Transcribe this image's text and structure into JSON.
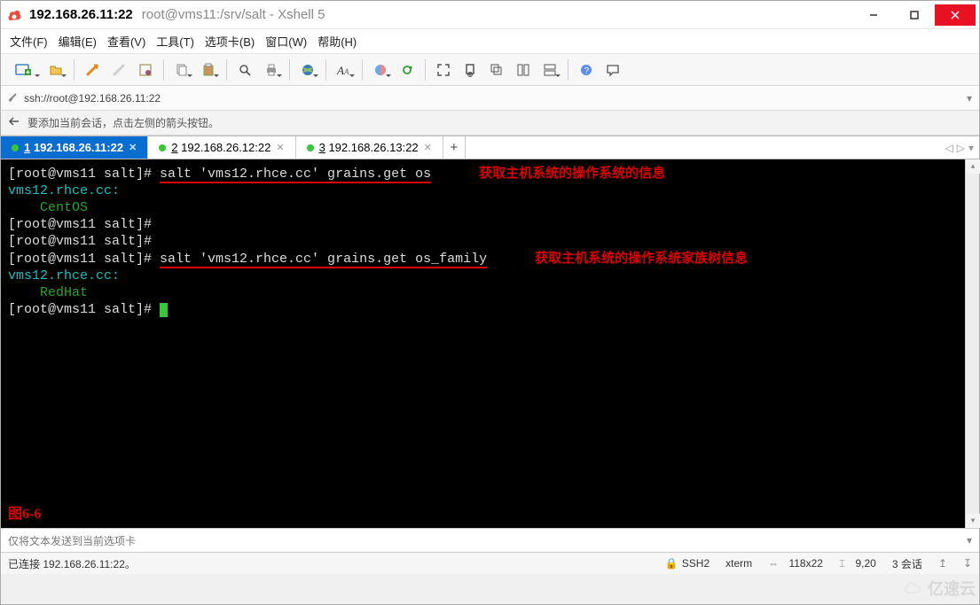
{
  "window": {
    "title_strong": "192.168.26.11:22",
    "title_rest": "root@vms11:/srv/salt - Xshell 5"
  },
  "menu": {
    "file": "文件(F)",
    "edit": "编辑(E)",
    "view": "查看(V)",
    "tools": "工具(T)",
    "tabs": "选项卡(B)",
    "window": "窗口(W)",
    "help": "帮助(H)"
  },
  "toolbar_icons": {
    "new_session": "new-session",
    "open": "open",
    "reconnect": "reconnect",
    "disconnect": "disconnect",
    "properties": "properties",
    "copy": "copy",
    "paste": "paste",
    "find": "find",
    "print": "print",
    "globe": "globe",
    "font": "font",
    "color": "color-scheme",
    "refresh": "refresh",
    "fullscreen": "fullscreen",
    "simple": "simple-mode",
    "cascade": "cascade",
    "tile_h": "tile-horizontal",
    "tile_v": "tile-vertical",
    "help": "help",
    "feedback": "feedback"
  },
  "address": {
    "url": "ssh://root@192.168.26.11:22"
  },
  "hint": {
    "text": "要添加当前会话，点击左侧的箭头按钮。"
  },
  "tabs": [
    {
      "n": "1",
      "label": "192.168.26.11:22",
      "active": true
    },
    {
      "n": "2",
      "label": "192.168.26.12:22",
      "active": false
    },
    {
      "n": "3",
      "label": "192.168.26.13:22",
      "active": false
    }
  ],
  "terminal": {
    "l1_prompt": "[root@vms11 salt]# ",
    "l1_cmd": "salt 'vms12.rhce.cc' grains.get os",
    "l1_annot": "获取主机系统的操作系统的信息",
    "l2_host": "vms12.rhce.cc:",
    "l3_value": "    CentOS",
    "l4_prompt": "[root@vms11 salt]# ",
    "l5_prompt": "[root@vms11 salt]# ",
    "l6_prompt": "[root@vms11 salt]# ",
    "l6_cmd": "salt 'vms12.rhce.cc' grains.get os_family",
    "l6_annot": "获取主机系统的操作系统家族树信息",
    "l7_host": "vms12.rhce.cc:",
    "l8_value": "    RedHat",
    "l9_prompt": "[root@vms11 salt]# ",
    "figure_label": "图6-6"
  },
  "sendbar": {
    "placeholder": "仅将文本发送到当前选项卡"
  },
  "status": {
    "connected": "已连接  192.168.26.11:22。",
    "proto": "SSH2",
    "termtype": "xterm",
    "size": "118x22",
    "cursor": "9,20",
    "sessions": "3 会话"
  },
  "watermark": {
    "text": "亿速云"
  }
}
